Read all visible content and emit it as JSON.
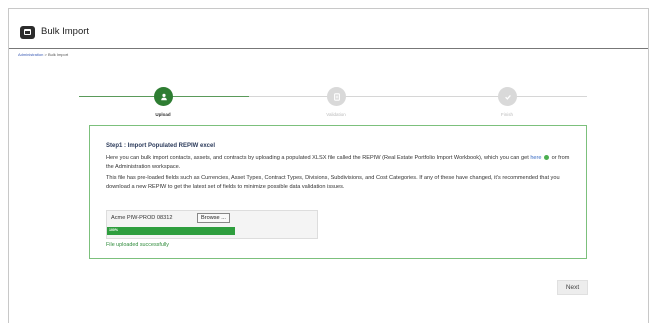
{
  "app": {
    "title": "Bulk Import",
    "icon": "import-icon"
  },
  "breadcrumb": {
    "items": [
      "Administration",
      "Bulk Import"
    ],
    "separator": ">"
  },
  "stepper": {
    "steps": [
      {
        "label": "Upload",
        "state": "active",
        "icon": "upload-icon"
      },
      {
        "label": "Validation",
        "state": "pending",
        "icon": "validation-icon"
      },
      {
        "label": "Finish",
        "state": "pending",
        "icon": "check-icon"
      }
    ]
  },
  "card": {
    "title": "Step1 : Import Populated REPIW excel",
    "para1_before": "Here you can bulk import contacts, assets, and contracts by uploading a populated XLSX file called the REPIW (Real Estate Portfolio Import Workbook), which you can get ",
    "para1_link": "here",
    "para1_after": " or from the Administration workspace.",
    "para2": "This file has pre-loaded fields such as Currencies, Asset Types, Contract Types, Divisions, Subdivisions, and Cost Categories. If any of these have changed, it's recommended that you download a new REPIW to get the latest set of fields to minimize possible data validation issues.",
    "file_name": "Acme PIW-PROD 08312",
    "browse_label": "Browse ...",
    "progress_text": "100%",
    "progress_value": 1.0,
    "status_text": "File uploaded successfully"
  },
  "actions": {
    "next_label": "Next"
  },
  "colors": {
    "accent": "#2e7d32",
    "progress": "#2e9e3e",
    "link": "#3b6dc4",
    "card_border": "#7cc07c"
  }
}
